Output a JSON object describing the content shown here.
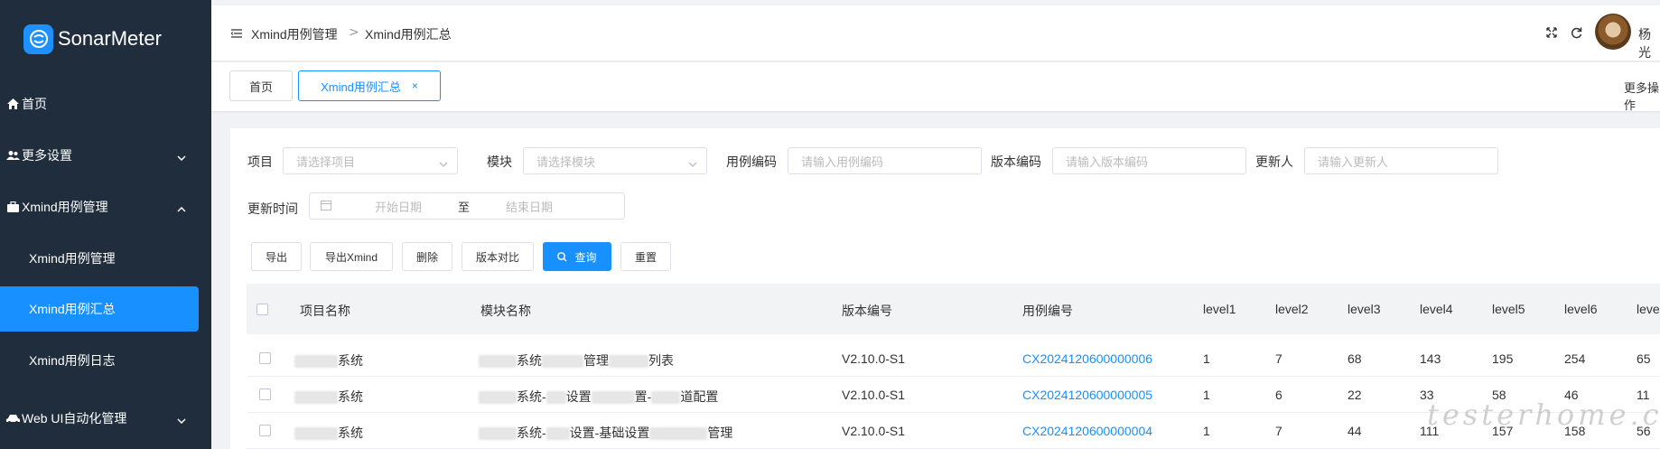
{
  "app": {
    "name": "SonarMeter"
  },
  "sidebar": {
    "items": [
      {
        "label": "首页",
        "icon": "home-icon"
      },
      {
        "label": "更多设置",
        "icon": "users-icon"
      },
      {
        "label": "Xmind用例管理",
        "icon": "briefcase-icon"
      },
      {
        "label": "Web UI自动化管理",
        "icon": "car-icon"
      }
    ],
    "sub_items": [
      {
        "label": "Xmind用例管理"
      },
      {
        "label": "Xmind用例汇总"
      },
      {
        "label": "Xmind用例日志"
      }
    ]
  },
  "header": {
    "breadcrumb": [
      "Xmind用例管理",
      "Xmind用例汇总"
    ],
    "breadcrumb_sep": ">",
    "user": "杨光"
  },
  "tabs": [
    {
      "label": "首页"
    },
    {
      "label": "Xmind用例汇总",
      "close": "×"
    }
  ],
  "more_ops": "更多操作",
  "filters": {
    "project": {
      "label": "项目",
      "placeholder": "请选择项目"
    },
    "module": {
      "label": "模块",
      "placeholder": "请选择模块"
    },
    "case_code": {
      "label": "用例编码",
      "placeholder": "请输入用例编码"
    },
    "version_code": {
      "label": "版本编码",
      "placeholder": "请输入版本编码"
    },
    "updater": {
      "label": "更新人",
      "placeholder": "请输入更新人"
    },
    "update_time": {
      "label": "更新时间",
      "start": "开始日期",
      "sep": "至",
      "end": "结束日期"
    }
  },
  "buttons": {
    "export": "导出",
    "export_xmind": "导出Xmind",
    "delete": "删除",
    "version_compare": "版本对比",
    "query": "查询",
    "reset": "重置"
  },
  "table": {
    "columns": [
      "项目名称",
      "模块名称",
      "版本编号",
      "用例编号",
      "level1",
      "level2",
      "level3",
      "level4",
      "level5",
      "level6",
      "leve"
    ],
    "rows": [
      {
        "project": "系统",
        "module_parts": [
          "系统",
          "管理",
          "列表"
        ],
        "version": "V2.10.0-S1",
        "case": "CX2024120600000006",
        "levels": [
          "1",
          "7",
          "68",
          "143",
          "195",
          "254",
          "65"
        ]
      },
      {
        "project": "系统",
        "module_parts": [
          "系统-",
          "设置",
          "置-",
          "道配置"
        ],
        "version": "V2.10.0-S1",
        "case": "CX2024120600000005",
        "levels": [
          "1",
          "6",
          "22",
          "33",
          "58",
          "46",
          "11"
        ]
      },
      {
        "project": "系统",
        "module_parts": [
          "系统-",
          "设置-基础设置",
          "管理"
        ],
        "version": "V2.10.0-S1",
        "case": "CX2024120600000004",
        "levels": [
          "1",
          "7",
          "44",
          "111",
          "157",
          "158",
          "56"
        ]
      }
    ]
  },
  "watermark": "testerhome.com",
  "colors": {
    "sidebar_bg": "#1f2d3d",
    "accent": "#1890ff",
    "link": "#1890ff"
  }
}
